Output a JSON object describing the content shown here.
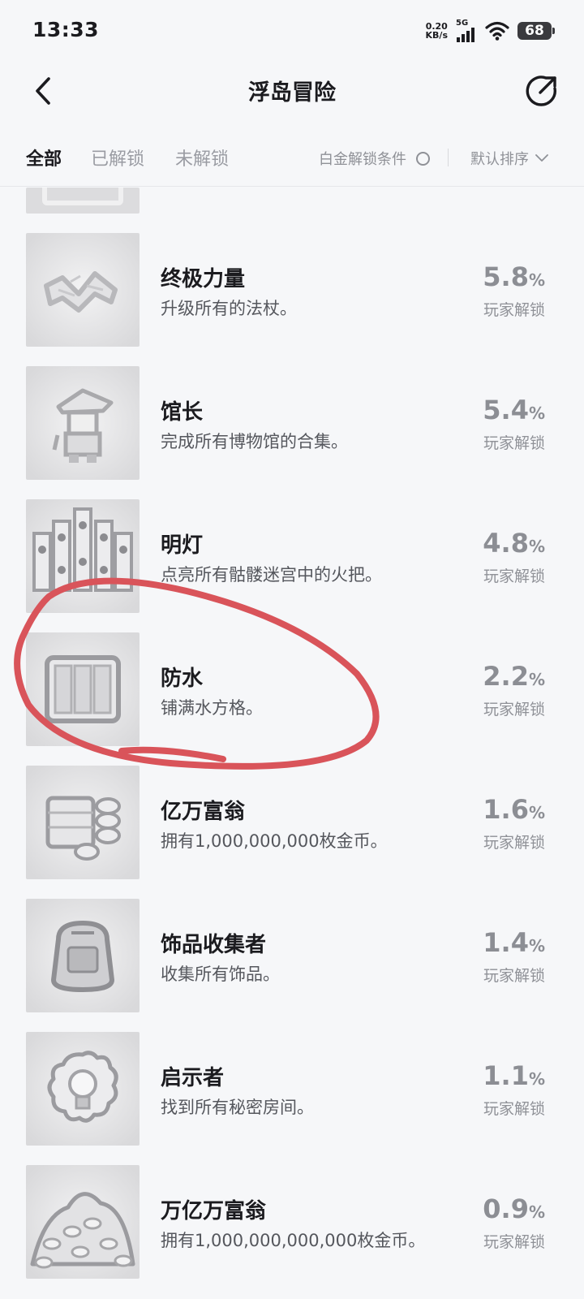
{
  "status_bar": {
    "time": "13:33",
    "net_speed_value": "0.20",
    "net_speed_unit": "KB/s",
    "signal_label": "5G",
    "battery": "68"
  },
  "header": {
    "title": "浮岛冒险",
    "back_icon": "chevron-left-icon",
    "share_icon": "share-icon"
  },
  "tabs": {
    "all": "全部",
    "unlocked": "已解锁",
    "locked": "未解锁",
    "platinum_filter": "白金解锁条件",
    "sort": "默认排序"
  },
  "achievements": [
    {
      "title": "终极力量",
      "desc": "升级所有的法杖。",
      "pct_value": "5.8",
      "pct_unit": "%",
      "pct_label": "玩家解锁",
      "icon": "staffs-icon"
    },
    {
      "title": "馆长",
      "desc": "完成所有博物馆的合集。",
      "pct_value": "5.4",
      "pct_unit": "%",
      "pct_label": "玩家解锁",
      "icon": "curator-character-icon"
    },
    {
      "title": "明灯",
      "desc": "点亮所有骷髅迷宫中的火把。",
      "pct_value": "4.8",
      "pct_unit": "%",
      "pct_label": "玩家解锁",
      "icon": "skull-torches-icon"
    },
    {
      "title": "防水",
      "desc": "铺满水方格。",
      "pct_value": "2.2",
      "pct_unit": "%",
      "pct_label": "玩家解锁",
      "icon": "water-tiles-icon"
    },
    {
      "title": "亿万富翁",
      "desc": "拥有1,000,000,000枚金币。",
      "pct_value": "1.6",
      "pct_unit": "%",
      "pct_label": "玩家解锁",
      "icon": "coin-stack-icon"
    },
    {
      "title": "饰品收集者",
      "desc": "收集所有饰品。",
      "pct_value": "1.4",
      "pct_unit": "%",
      "pct_label": "玩家解锁",
      "icon": "backpack-icon"
    },
    {
      "title": "启示者",
      "desc": "找到所有秘密房间。",
      "pct_value": "1.1",
      "pct_unit": "%",
      "pct_label": "玩家解锁",
      "icon": "lightbulb-icon"
    },
    {
      "title": "万亿万富翁",
      "desc": "拥有1,000,000,000,000枚金币。",
      "pct_value": "0.9",
      "pct_unit": "%",
      "pct_label": "玩家解锁",
      "icon": "treasure-pile-icon"
    }
  ],
  "colors": {
    "background": "#f6f7f9",
    "annotation_circle": "#d9545a",
    "percent_text": "#8c8e94"
  }
}
